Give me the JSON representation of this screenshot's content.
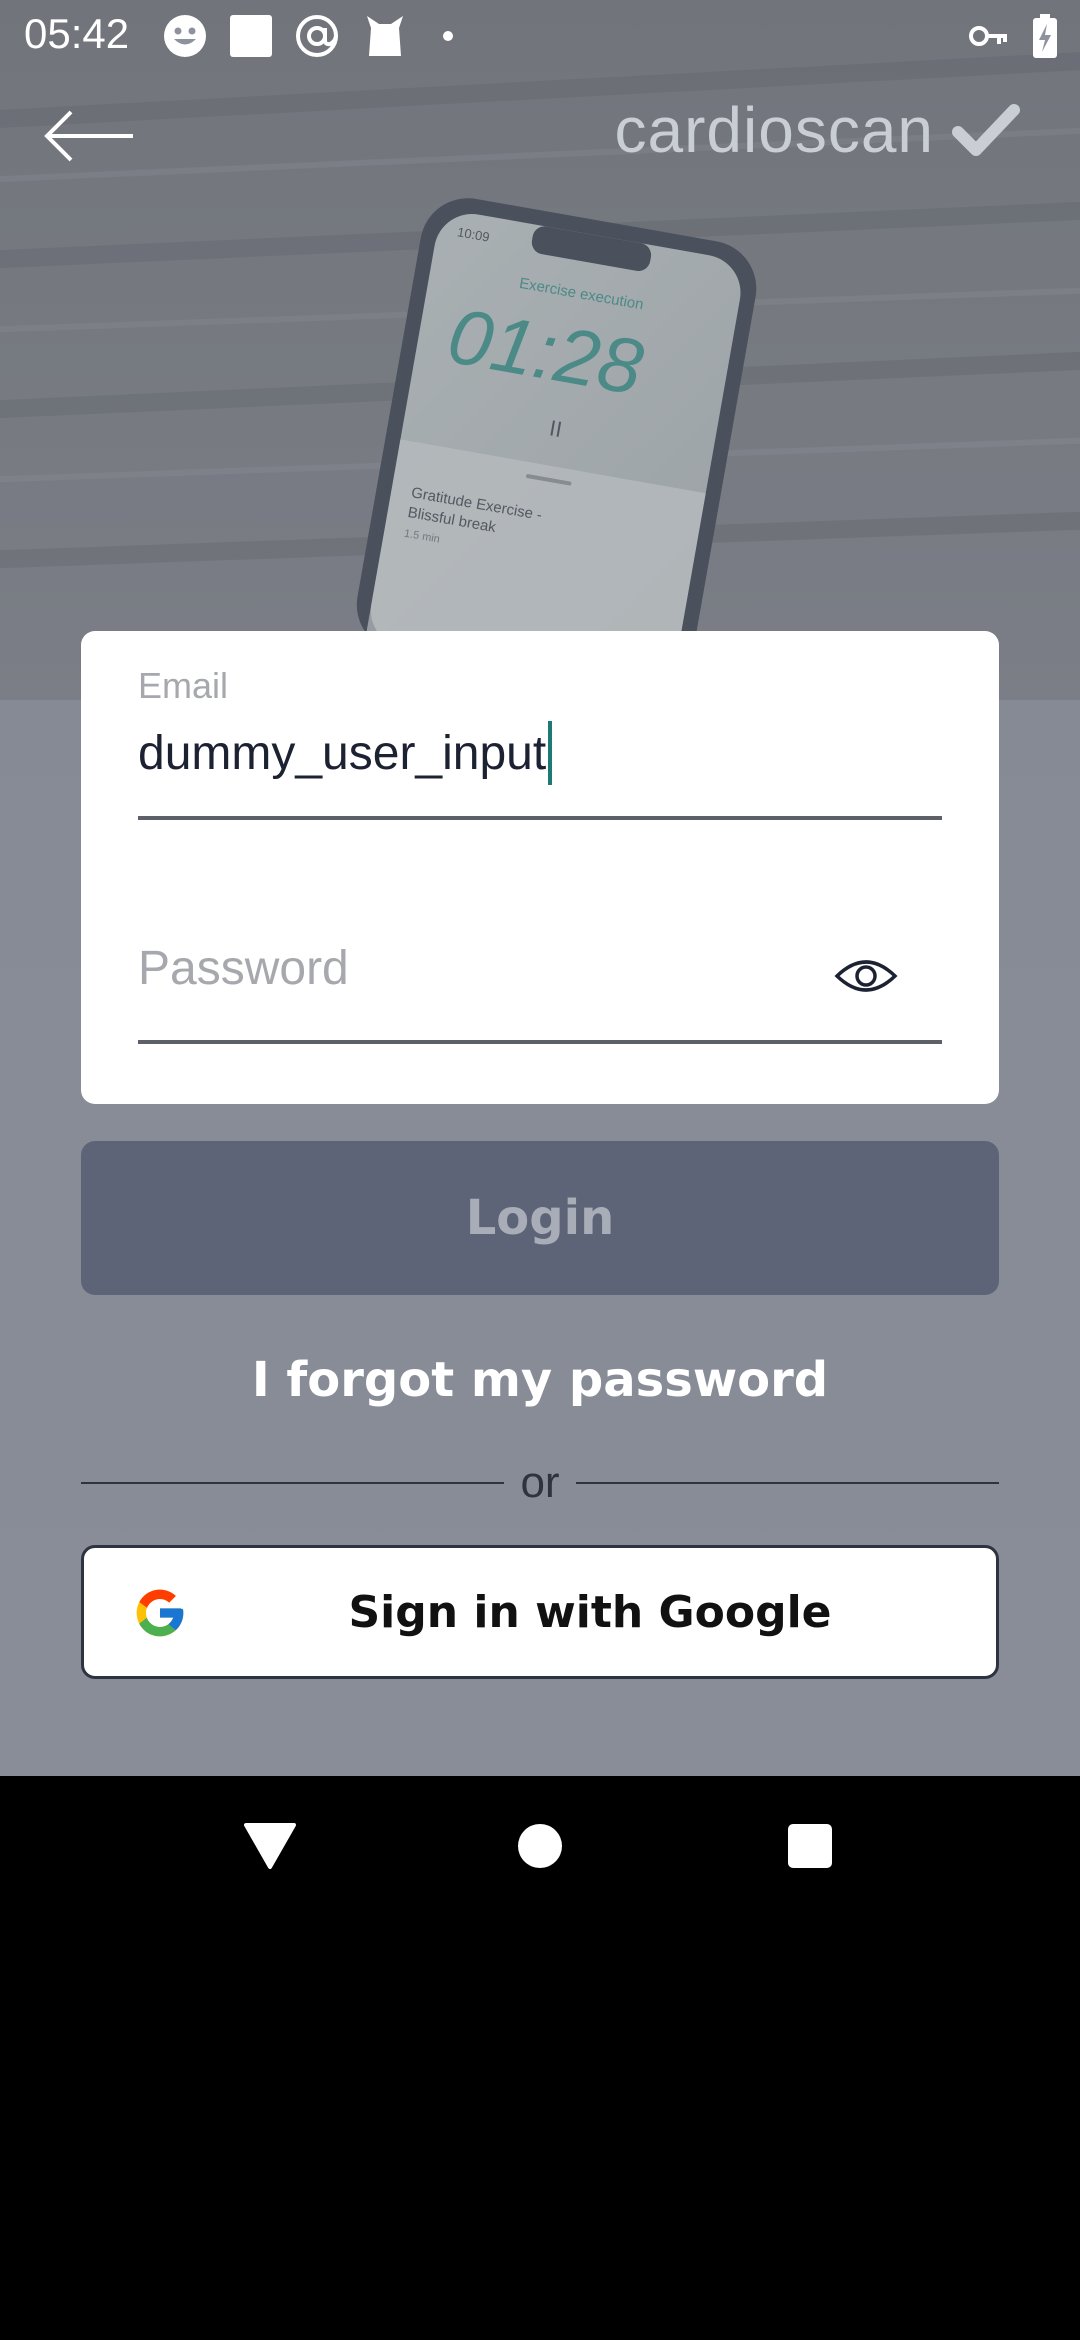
{
  "status_bar": {
    "time": "05:42",
    "left_icons": [
      "smiley-icon",
      "square-icon",
      "at-icon",
      "cat-icon",
      "dot-icon"
    ],
    "right_icons": [
      "key-icon",
      "battery-charging-icon"
    ]
  },
  "header": {
    "brand": "cardioscan",
    "back_icon": "arrow-left-icon",
    "check_icon": "checkmark-icon"
  },
  "background_phone": {
    "time": "10:09",
    "title": "Exercise execution",
    "timer": "01:28",
    "item_title_line1": "Gratitude Exercise -",
    "item_title_line2": "Blissful break",
    "item_meta": "1.5 min"
  },
  "form": {
    "email_label": "Email",
    "email_value": "dummy_user_input",
    "password_placeholder": "Password",
    "login_label": "Login",
    "forgot_label": "I forgot my password",
    "divider_text": "or",
    "google_label": "Sign in with Google"
  },
  "colors": {
    "primary_button": "#5d6477",
    "caret": "#1d7a72",
    "background": "#8d929c"
  }
}
